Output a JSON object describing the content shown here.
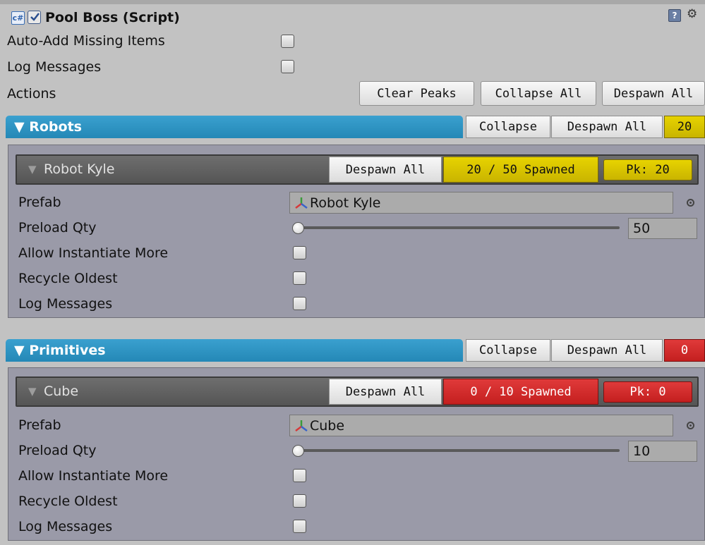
{
  "component": {
    "title": "Pool Boss (Script)",
    "script_icon": "c#",
    "help_icon": "?",
    "gear_icon": "⚙",
    "enabled": true
  },
  "settings": {
    "auto_add_label": "Auto-Add Missing Items",
    "log_messages_label": "Log Messages",
    "actions_label": "Actions"
  },
  "actions": {
    "clear_peaks": "Clear Peaks",
    "collapse_all": "Collapse All",
    "despawn_all": "Despawn All"
  },
  "groups": [
    {
      "title": "▼ Robots",
      "collapse": "Collapse",
      "despawn_all": "Despawn All",
      "count": "20",
      "count_color": "yellow",
      "item": {
        "name": "Robot Kyle",
        "despawn_all": "Despawn All",
        "spawned": "20 / 50 Spawned",
        "peak": "Pk: 20",
        "prefab_label": "Prefab",
        "prefab_value": "Robot Kyle",
        "preload_label": "Preload Qty",
        "preload_value": "50",
        "allow_more_label": "Allow Instantiate More",
        "recycle_label": "Recycle Oldest",
        "log_label": "Log Messages"
      }
    },
    {
      "title": "▼ Primitives",
      "collapse": "Collapse",
      "despawn_all": "Despawn All",
      "count": "0",
      "count_color": "red",
      "item": {
        "name": "Cube",
        "despawn_all": "Despawn All",
        "spawned": "0 / 10 Spawned",
        "peak": "Pk: 0",
        "prefab_label": "Prefab",
        "prefab_value": "Cube",
        "preload_label": "Preload Qty",
        "preload_value": "10",
        "allow_more_label": "Allow Instantiate More",
        "recycle_label": "Recycle Oldest",
        "log_label": "Log Messages"
      }
    }
  ],
  "colors": {
    "group_header": "#2f93c3",
    "badge_yellow": "#d9c400",
    "badge_red": "#d42a2a",
    "panel": "#9a9aa8"
  }
}
